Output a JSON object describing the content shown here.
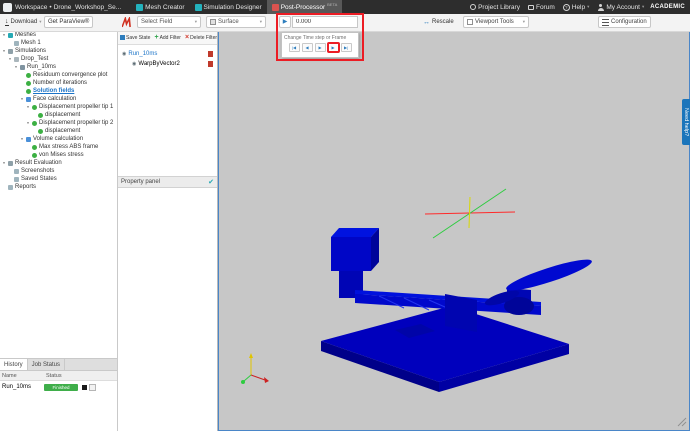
{
  "topbar": {
    "workspace_label": "Workspace",
    "separator": "•",
    "project_name": "Drone_Workshop_Se...",
    "tabs": [
      {
        "label": "Mesh Creator",
        "icon": "mesh-creator-icon",
        "active": false
      },
      {
        "label": "Simulation Designer",
        "icon": "simulation-designer-icon",
        "active": false
      },
      {
        "label": "Post-Processor",
        "icon": "post-processor-icon",
        "badge": "BETA",
        "active": true
      }
    ],
    "right_menu": [
      {
        "label": "Project Library",
        "icon": "library-icon",
        "caret": false
      },
      {
        "label": "Forum",
        "icon": "forum-icon",
        "caret": false
      },
      {
        "label": "Help",
        "icon": "help-icon",
        "caret": true
      },
      {
        "label": "My Account",
        "icon": "account-icon",
        "caret": true
      }
    ],
    "plan_badge": "ACADEMIC"
  },
  "toolbar": {
    "download_label": "Download",
    "paraview_label": "Get ParaView®",
    "select_field_label": "Select Field",
    "surface_label": "Surface",
    "time_value": "0.000",
    "rescale_label": "Rescale",
    "viewport_tools_label": "Viewport Tools",
    "configuration_label": "Configuration"
  },
  "time_panel": {
    "tooltip": "Change Time step or Frame",
    "buttons": [
      {
        "name": "first-frame",
        "glyph": "|◀",
        "highlight": false
      },
      {
        "name": "previous-frame",
        "glyph": "◀",
        "highlight": false
      },
      {
        "name": "play",
        "glyph": "▶",
        "highlight": false
      },
      {
        "name": "next-frame",
        "glyph": "▶",
        "highlight": true
      },
      {
        "name": "last-frame",
        "glyph": "▶|",
        "highlight": false
      }
    ]
  },
  "sidebar": {
    "tree": [
      {
        "label": "Meshes",
        "depth": 0,
        "icon": "grid",
        "caret": true,
        "selected": false
      },
      {
        "label": "Mesh 1",
        "depth": 1,
        "icon": "mesh",
        "caret": false,
        "selected": false
      },
      {
        "label": "Simulations",
        "depth": 0,
        "icon": "sim",
        "caret": true,
        "selected": false
      },
      {
        "label": "Drop_Test",
        "depth": 1,
        "icon": "folder",
        "caret": true,
        "selected": false
      },
      {
        "label": "Run_10ms",
        "depth": 2,
        "icon": "run",
        "caret": true,
        "selected": false
      },
      {
        "label": "Residuum convergence plot",
        "depth": 3,
        "icon": "dot",
        "caret": false,
        "selected": false
      },
      {
        "label": "Number of iterations",
        "depth": 3,
        "icon": "dot",
        "caret": false,
        "selected": false
      },
      {
        "label": "Solution fields",
        "depth": 3,
        "icon": "dot",
        "caret": false,
        "selected": true
      },
      {
        "label": "Face calculation",
        "depth": 3,
        "icon": "calc",
        "caret": true,
        "selected": false
      },
      {
        "label": "Displacement propeller tip 1",
        "depth": 4,
        "icon": "dot",
        "caret": true,
        "selected": false
      },
      {
        "label": "displacement",
        "depth": 5,
        "icon": "dot",
        "caret": false,
        "selected": false
      },
      {
        "label": "Displacement propeller tip 2",
        "depth": 4,
        "icon": "dot",
        "caret": true,
        "selected": false
      },
      {
        "label": "displacement",
        "depth": 5,
        "icon": "dot",
        "caret": false,
        "selected": false
      },
      {
        "label": "Volume calculation",
        "depth": 3,
        "icon": "calc",
        "caret": true,
        "selected": false
      },
      {
        "label": "Max stress ABS frame",
        "depth": 4,
        "icon": "dot",
        "caret": false,
        "selected": false
      },
      {
        "label": "von Mises stress",
        "depth": 4,
        "icon": "dot",
        "caret": false,
        "selected": false
      },
      {
        "label": "Result Evaluation",
        "depth": 0,
        "icon": "eval",
        "caret": true,
        "selected": false
      },
      {
        "label": "Screenshots",
        "depth": 1,
        "icon": "camera",
        "caret": false,
        "selected": false
      },
      {
        "label": "Saved States",
        "depth": 1,
        "icon": "save",
        "caret": false,
        "selected": false
      },
      {
        "label": "Reports",
        "depth": 0,
        "icon": "report",
        "caret": false,
        "selected": false
      }
    ]
  },
  "history_panel": {
    "tabs": [
      {
        "label": "History",
        "active": true
      },
      {
        "label": "Job Status",
        "active": false
      }
    ],
    "columns": [
      "Name",
      "Status"
    ],
    "rows": [
      {
        "name": "Run_10ms",
        "status": "Finished"
      }
    ]
  },
  "filter_panel": {
    "save_state_label": "Save State",
    "add_filter_label": "Add Filter",
    "delete_filter_label": "Delete Filter",
    "pipeline": [
      {
        "label": "Run_10ms",
        "depth": 0,
        "link": true
      },
      {
        "label": "WarpByVector2",
        "depth": 1,
        "link": false
      }
    ],
    "property_panel_label": "Property panel"
  },
  "viewport": {
    "need_help_label": "Need help?"
  },
  "icons": {
    "caret_down": "▾",
    "download_arrow": "↓",
    "play": "▶",
    "rescale": "↔",
    "check": "✔",
    "eye": "◉",
    "add": "+",
    "delete": "×"
  },
  "colors": {
    "accent_teal": "#23b2bd",
    "post_processor_red": "#d9534f",
    "highlight_red": "#ec1c24",
    "model_blue": "#0000c8",
    "status_green": "#3fae4a",
    "link_blue": "#1a73c7",
    "need_help_blue": "#1b75bb",
    "viewport_gray": "#c7c7c7"
  }
}
